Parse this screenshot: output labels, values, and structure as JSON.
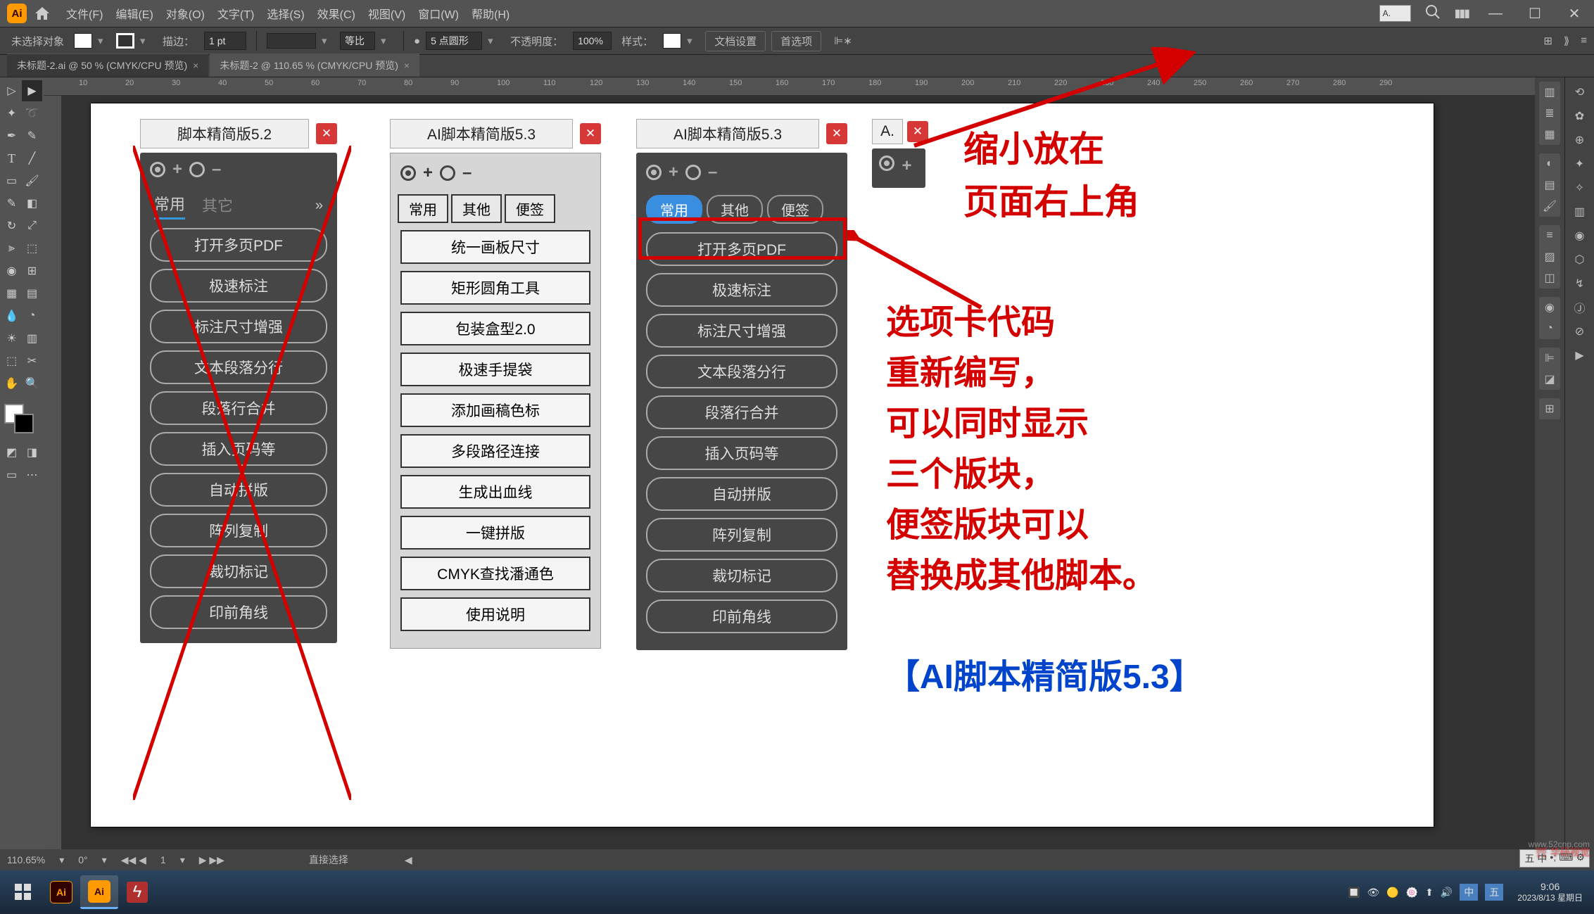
{
  "menubar": {
    "logo": "Ai",
    "items": [
      "文件(F)",
      "编辑(E)",
      "对象(O)",
      "文字(T)",
      "选择(S)",
      "效果(C)",
      "视图(V)",
      "窗口(W)",
      "帮助(H)"
    ],
    "mini_panel": "A."
  },
  "controlbar": {
    "no_select": "未选择对象",
    "stroke_label": "描边：",
    "stroke_val": "1 pt",
    "uniform": "等比",
    "brush_val": "5 点圆形",
    "opacity_label": "不透明度：",
    "opacity_val": "100%",
    "style_label": "样式：",
    "doc_setup": "文档设置",
    "prefs": "首选项"
  },
  "tabs": {
    "tab1": "未标题-2.ai @ 50 % (CMYK/CPU 预览)",
    "tab2": "未标题-2 @ 110.65 % (CMYK/CPU 预览)"
  },
  "ruler": {
    "ticks": [
      "10",
      "20",
      "30",
      "40",
      "50",
      "60",
      "70",
      "80",
      "90",
      "100",
      "110",
      "120",
      "130",
      "140",
      "150",
      "160",
      "170",
      "180",
      "190",
      "200",
      "210",
      "220",
      "230",
      "240",
      "250",
      "260",
      "270",
      "280",
      "290"
    ]
  },
  "panel52": {
    "title": "脚本精简版5.2",
    "tabs": {
      "t1": "常用",
      "t2": "其它"
    },
    "buttons": [
      "打开多页PDF",
      "极速标注",
      "标注尺寸增强",
      "文本段落分行",
      "段落行合并",
      "插入页码等",
      "自动拼版",
      "阵列复制",
      "裁切标记",
      "印前角线"
    ]
  },
  "panel53a": {
    "title": "AI脚本精简版5.3",
    "tabs": {
      "t1": "常用",
      "t2": "其他",
      "t3": "便签"
    },
    "buttons": [
      "统一画板尺寸",
      "矩形圆角工具",
      "包装盒型2.0",
      "极速手提袋",
      "添加画稿色标",
      "多段路径连接",
      "生成出血线",
      "一键拼版",
      "CMYK查找潘通色",
      "使用说明"
    ]
  },
  "panel53b": {
    "title": "AI脚本精简版5.3",
    "tabs": {
      "t1": "常用",
      "t2": "其他",
      "t3": "便签"
    },
    "buttons": [
      "打开多页PDF",
      "极速标注",
      "标注尺寸增强",
      "文本段落分行",
      "段落行合并",
      "插入页码等",
      "自动拼版",
      "阵列复制",
      "裁切标记",
      "印前角线"
    ]
  },
  "panel_mini": {
    "title": "A."
  },
  "annotations": {
    "a1_l1": "缩小放在",
    "a1_l2": "页面右上角",
    "a2_l1": "选项卡代码",
    "a2_l2": "重新编写，",
    "a2_l3": "可以同时显示",
    "a2_l4": "三个版块，",
    "a2_l5": "便签版块可以",
    "a2_l6": "替换成其他脚本。",
    "a3": "【AI脚本精简版5.3】"
  },
  "statusbar": {
    "zoom": "110.65%",
    "rotate": "0°",
    "page": "1",
    "tool": "直接选择"
  },
  "taskbar": {
    "time": "9:06",
    "date": "2023/8/13 星期日"
  },
  "watermark": "华研视觉",
  "watermark_url": "www.52cnp.com"
}
